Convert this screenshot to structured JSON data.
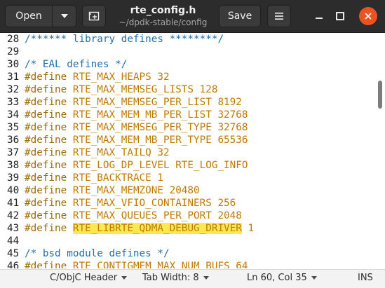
{
  "header": {
    "open_label": "Open",
    "save_label": "Save",
    "title": "rte_config.h",
    "subtitle": "~/dpdk-stable/config"
  },
  "icons": {
    "open_dropdown": "chevron-down-icon",
    "new_tab": "new-tab-icon",
    "menu": "hamburger-menu-icon",
    "minimize": "minimize-icon",
    "maximize": "maximize-icon",
    "close": "close-icon"
  },
  "colors": {
    "header_bg": "#2c2c2c",
    "close_button": "#e95420",
    "comment": "#1f6fad",
    "preprocessor": "#9c6b00",
    "highlight": "#fce94f"
  },
  "editor": {
    "lines": [
      {
        "num": "28",
        "parts": [
          {
            "t": "/****** library defines ********/",
            "c": "comment"
          }
        ]
      },
      {
        "num": "29",
        "parts": []
      },
      {
        "num": "30",
        "parts": [
          {
            "t": "/* EAL defines */",
            "c": "comment"
          }
        ]
      },
      {
        "num": "31",
        "parts": [
          {
            "t": "#define ",
            "c": "kw"
          },
          {
            "t": "RTE_MAX_HEAPS 32",
            "c": "macro"
          }
        ]
      },
      {
        "num": "32",
        "parts": [
          {
            "t": "#define ",
            "c": "kw"
          },
          {
            "t": "RTE_MAX_MEMSEG_LISTS 128",
            "c": "macro"
          }
        ]
      },
      {
        "num": "33",
        "parts": [
          {
            "t": "#define ",
            "c": "kw"
          },
          {
            "t": "RTE_MAX_MEMSEG_PER_LIST 8192",
            "c": "macro"
          }
        ]
      },
      {
        "num": "34",
        "parts": [
          {
            "t": "#define ",
            "c": "kw"
          },
          {
            "t": "RTE_MAX_MEM_MB_PER_LIST 32768",
            "c": "macro"
          }
        ]
      },
      {
        "num": "35",
        "parts": [
          {
            "t": "#define ",
            "c": "kw"
          },
          {
            "t": "RTE_MAX_MEMSEG_PER_TYPE 32768",
            "c": "macro"
          }
        ]
      },
      {
        "num": "36",
        "parts": [
          {
            "t": "#define ",
            "c": "kw"
          },
          {
            "t": "RTE_MAX_MEM_MB_PER_TYPE 65536",
            "c": "macro"
          }
        ]
      },
      {
        "num": "37",
        "parts": [
          {
            "t": "#define ",
            "c": "kw"
          },
          {
            "t": "RTE_MAX_TAILQ 32",
            "c": "macro"
          }
        ]
      },
      {
        "num": "38",
        "parts": [
          {
            "t": "#define ",
            "c": "kw"
          },
          {
            "t": "RTE_LOG_DP_LEVEL RTE_LOG_INFO",
            "c": "macro"
          }
        ]
      },
      {
        "num": "39",
        "parts": [
          {
            "t": "#define ",
            "c": "kw"
          },
          {
            "t": "RTE_BACKTRACE 1",
            "c": "macro"
          }
        ]
      },
      {
        "num": "40",
        "parts": [
          {
            "t": "#define ",
            "c": "kw"
          },
          {
            "t": "RTE_MAX_MEMZONE 20480",
            "c": "macro"
          }
        ]
      },
      {
        "num": "41",
        "parts": [
          {
            "t": "#define ",
            "c": "kw"
          },
          {
            "t": "RTE_MAX_VFIO_CONTAINERS 256",
            "c": "macro"
          }
        ]
      },
      {
        "num": "42",
        "parts": [
          {
            "t": "#define ",
            "c": "kw"
          },
          {
            "t": "RTE_MAX_QUEUES_PER_PORT 2048",
            "c": "macro"
          }
        ]
      },
      {
        "num": "43",
        "parts": [
          {
            "t": "#define ",
            "c": "kw"
          },
          {
            "t": "RTE_LIBRTE_QDMA_DEBUG_DRIVER",
            "c": "macro hl"
          },
          {
            "t": " 1",
            "c": "macro"
          }
        ]
      },
      {
        "num": "44",
        "parts": []
      },
      {
        "num": "45",
        "parts": [
          {
            "t": "/* bsd module defines */",
            "c": "comment"
          }
        ]
      },
      {
        "num": "46",
        "parts": [
          {
            "t": "#define ",
            "c": "kw"
          },
          {
            "t": "RTE_CONTIGMEM_MAX_NUM_BUFS 64",
            "c": "macro"
          }
        ]
      }
    ]
  },
  "statusbar": {
    "language": "C/ObjC Header",
    "tab_width": "Tab Width: 8",
    "position": "Ln 60, Col 35",
    "mode": "INS"
  }
}
